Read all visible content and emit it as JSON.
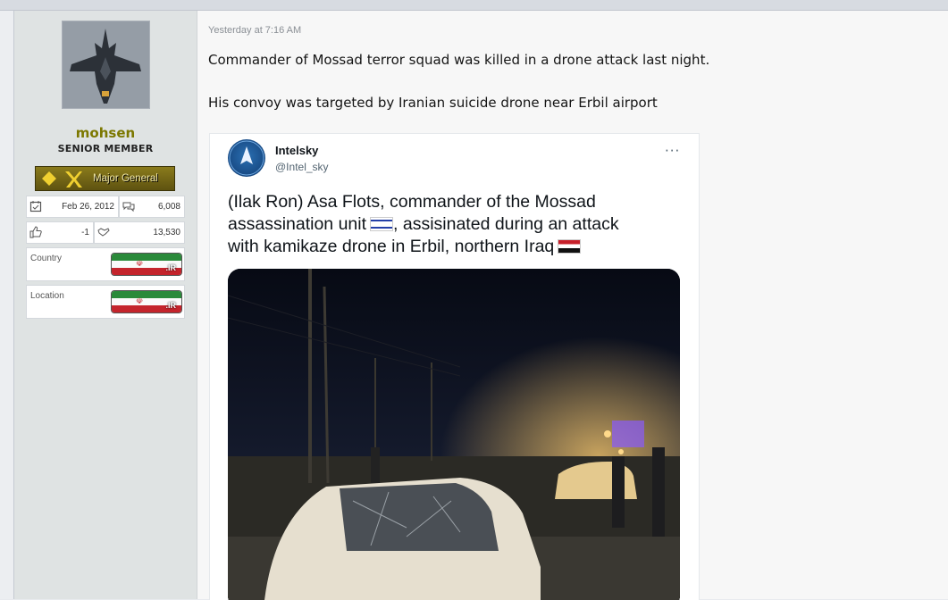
{
  "post": {
    "timestamp": "Yesterday at 7:16 AM",
    "line1": "Commander of Mossad terror squad was killed in a drone attack last night.",
    "line2": "His convoy was targeted by Iranian suicide drone near Erbil airport"
  },
  "user": {
    "name": "mohsen",
    "title": "SENIOR MEMBER",
    "rank": "Major General",
    "joined": "Feb 26, 2012",
    "messages": "6,008",
    "reactions": "-1",
    "points": "13,530",
    "country_label": "Country",
    "location_label": "Location",
    "flag_code": ".IR",
    "icons": [
      "calendar-icon",
      "messages-icon",
      "thumbs-up-icon",
      "handshake-icon"
    ]
  },
  "tweet": {
    "name": "Intelsky",
    "handle": "@Intel_sky",
    "more": "···",
    "text_line1": "(Ilak Ron) Asa Flots, commander of the Mossad",
    "text_line2a": "assassination unit",
    "text_line2b": ", assisinated during an attack",
    "text_line3": "with kamikaze drone in Erbil, northern Iraq"
  },
  "colors": {
    "username": "#7c7800",
    "sidebar": "#dfe3e3",
    "accent_link": "#1d9bf0"
  }
}
